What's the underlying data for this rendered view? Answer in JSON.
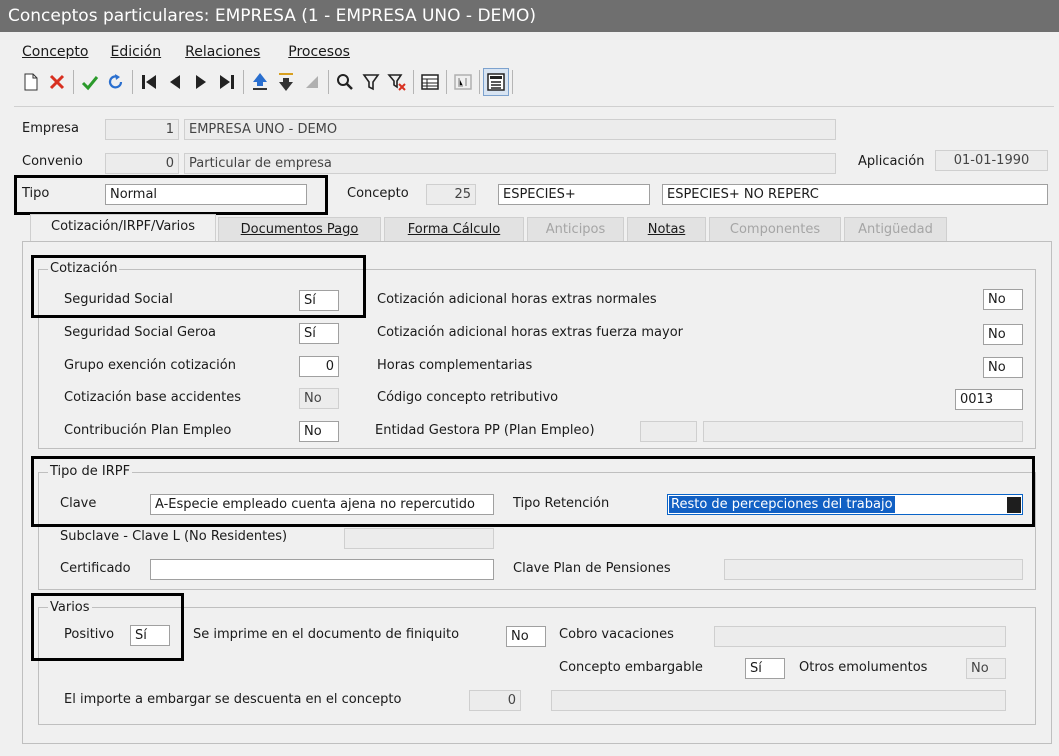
{
  "window": {
    "title": "Conceptos particulares: EMPRESA (1 - EMPRESA UNO - DEMO)"
  },
  "menu": [
    "Concepto",
    "Edición",
    "Relaciones",
    "Procesos"
  ],
  "header": {
    "empresa_label": "Empresa",
    "empresa_code": "1",
    "empresa_name": "EMPRESA UNO - DEMO",
    "convenio_label": "Convenio",
    "convenio_code": "0",
    "convenio_name": "Particular de empresa",
    "aplicacion_label": "Aplicación",
    "aplicacion_value": "01-01-1990",
    "tipo_label": "Tipo",
    "tipo_value": "Normal",
    "concepto_label": "Concepto",
    "concepto_code": "25",
    "concepto_short": "ESPECIES+",
    "concepto_long": "ESPECIES+ NO REPERC"
  },
  "tabs": [
    {
      "label": "Cotización/IRPF/Varios",
      "state": "selected"
    },
    {
      "label": "Documentos Pago",
      "state": "enabled"
    },
    {
      "label": "Forma Cálculo",
      "state": "enabled"
    },
    {
      "label": "Anticipos",
      "state": "disabled"
    },
    {
      "label": "Notas",
      "state": "enabled"
    },
    {
      "label": "Componentes",
      "state": "disabled"
    },
    {
      "label": "Antigüedad",
      "state": "disabled"
    }
  ],
  "cotizacion": {
    "title": "Cotización",
    "seg_social_label": "Seguridad Social",
    "seg_social": "Sí",
    "seg_social_geroa_label": "Seguridad Social Geroa",
    "seg_social_geroa": "Sí",
    "grupo_exencion_label": "Grupo exención cotización",
    "grupo_exencion": "0",
    "base_accidentes_label": "Cotización base accidentes",
    "base_accidentes": "No",
    "plan_empleo_label": "Contribución Plan Empleo",
    "plan_empleo": "No",
    "horas_normales_label": "Cotización adicional horas extras normales",
    "horas_normales": "No",
    "horas_fuerza_label": "Cotización adicional horas extras fuerza mayor",
    "horas_fuerza": "No",
    "horas_compl_label": "Horas complementarias",
    "horas_compl": "No",
    "codigo_retrib_label": "Código concepto retributivo",
    "codigo_retrib": "0013",
    "entidad_gestora_label": "Entidad Gestora PP (Plan Empleo)"
  },
  "irpf": {
    "title": "Tipo de IRPF",
    "clave_label": "Clave",
    "clave": "A-Especie empleado cuenta ajena no repercutido",
    "tipo_ret_label": "Tipo Retención",
    "tipo_ret": "Resto de percepciones del trabajo",
    "subclave_label": "Subclave - Clave L (No Residentes)",
    "certificado_label": "Certificado",
    "plan_pensiones_label": "Clave Plan de Pensiones"
  },
  "varios": {
    "title": "Varios",
    "positivo_label": "Positivo",
    "positivo": "Sí",
    "finiquito_label": "Se imprime en el documento de finiquito",
    "finiquito": "No",
    "cobro_vac_label": "Cobro vacaciones",
    "embargable_label": "Concepto embargable",
    "embargable": "Sí",
    "otros_emol_label": "Otros emolumentos",
    "otros_emol": "No",
    "importe_label": "El importe a embargar se descuenta en el concepto",
    "importe": "0"
  }
}
